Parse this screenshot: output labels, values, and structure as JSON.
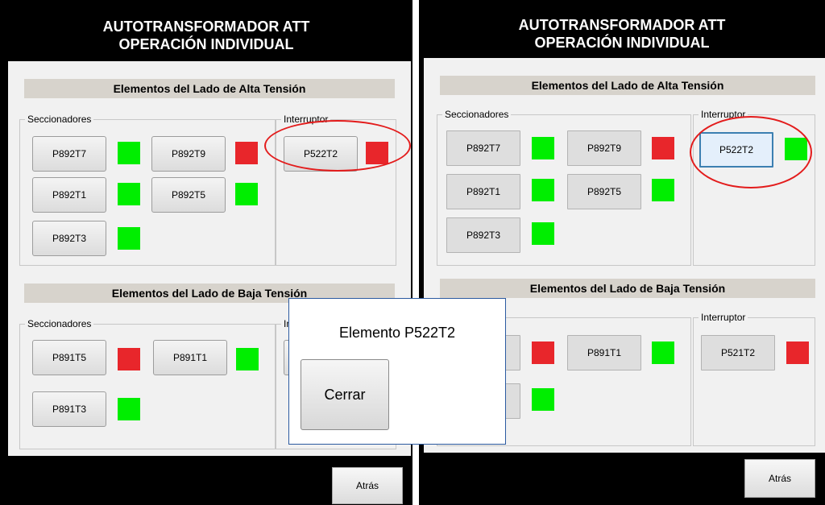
{
  "left": {
    "title_line1": "AUTOTRANSFORMADOR  ATT",
    "title_line2": "OPERACIÓN INDIVIDUAL",
    "alta_header": "Elementos del Lado de Alta Tensión",
    "alta_seccionadores_label": "Seccionadores",
    "alta_interruptor_label": "Interruptor",
    "alta_buttons": [
      "P892T7",
      "P892T9",
      "P892T1",
      "P892T5",
      "P892T3",
      "P522T2"
    ],
    "baja_header": "Elementos del Lado de Baja Tensión",
    "baja_seccionadores_label": "Seccionadores",
    "baja_interruptor_label": "In",
    "baja_buttons": [
      "P891T5",
      "P891T1",
      "P891T3"
    ],
    "back_label": "Atrás"
  },
  "right": {
    "title_line1": "AUTOTRANSFORMADOR  ATT",
    "title_line2": "OPERACIÓN INDIVIDUAL",
    "alta_header": "Elementos del Lado de Alta Tensión",
    "alta_seccionadores_label": "Seccionadores",
    "alta_interruptor_label": "Interruptor",
    "alta_buttons": [
      "P892T7",
      "P892T9",
      "P892T1",
      "P892T5",
      "P892T3",
      "P522T2"
    ],
    "baja_header": "Elementos del Lado de Baja Tensión",
    "baja_seccionadores_label": "s",
    "baja_interruptor_label": "Interruptor",
    "baja_buttons": [
      "P891T1",
      "P521T2"
    ],
    "back_label": "Atrás"
  },
  "dialog": {
    "title": "Elemento P522T2",
    "close_label": "Cerrar"
  },
  "colors": {
    "status_closed": "#00ee00",
    "status_open": "#e8262b",
    "highlight": "#e31c1c"
  }
}
